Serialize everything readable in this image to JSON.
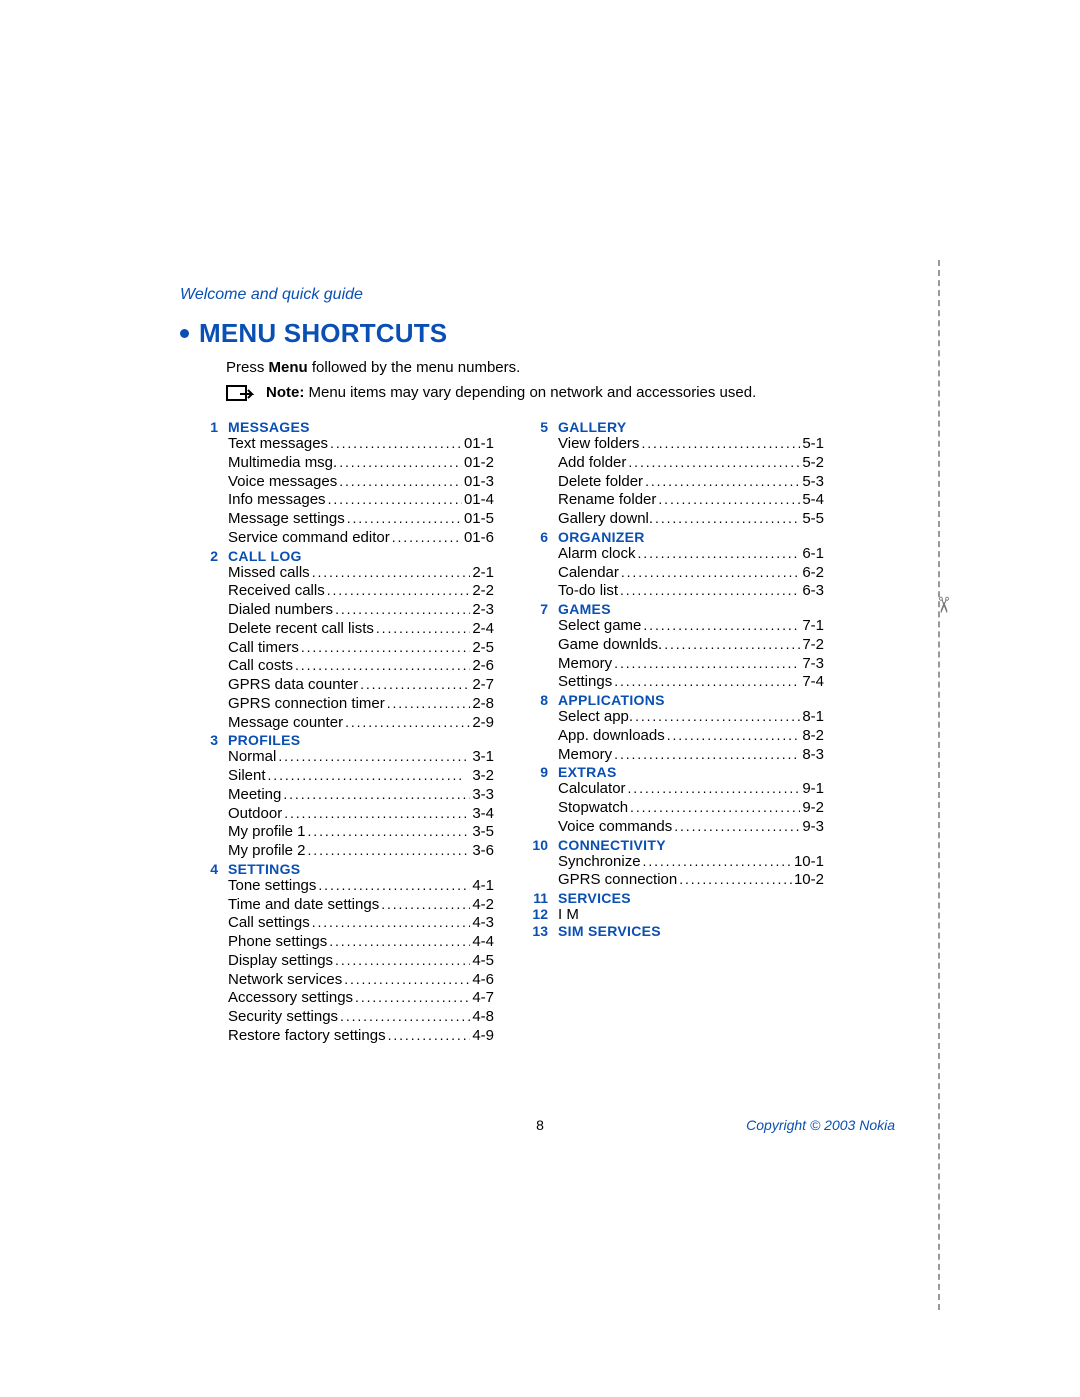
{
  "header_label": "Welcome and quick guide",
  "title": "MENU SHORTCUTS",
  "intro_prefix": "Press ",
  "intro_bold": "Menu",
  "intro_suffix": " followed by the menu numbers.",
  "note_bold": "Note:",
  "note_text": " Menu items may vary depending on network and accessories used.",
  "page_number": "8",
  "copyright": "Copyright © 2003 Nokia",
  "left": [
    {
      "num": "1",
      "title": "MESSAGES",
      "items": [
        {
          "label": "Text messages",
          "page": "01-1"
        },
        {
          "label": "Multimedia msg.",
          "page": "01-2"
        },
        {
          "label": "Voice messages",
          "page": "01-3"
        },
        {
          "label": "Info messages",
          "page": "01-4"
        },
        {
          "label": "Message settings",
          "page": "01-5"
        },
        {
          "label": "Service command editor",
          "page": "01-6"
        }
      ]
    },
    {
      "num": "2",
      "title": "CALL LOG",
      "items": [
        {
          "label": "Missed calls",
          "page": "2-1"
        },
        {
          "label": "Received calls",
          "page": "2-2"
        },
        {
          "label": "Dialed numbers",
          "page": "2-3"
        },
        {
          "label": "Delete recent call lists",
          "page": "2-4"
        },
        {
          "label": "Call timers",
          "page": "2-5"
        },
        {
          "label": "Call costs",
          "page": "2-6"
        },
        {
          "label": "GPRS data counter",
          "page": "2-7"
        },
        {
          "label": "GPRS connection timer",
          "page": "2-8"
        },
        {
          "label": "Message counter",
          "page": "2-9"
        }
      ]
    },
    {
      "num": "3",
      "title": "PROFILES",
      "items": [
        {
          "label": "Normal",
          "page": "3-1"
        },
        {
          "label": "Silent",
          "page": "3-2"
        },
        {
          "label": "Meeting",
          "page": "3-3"
        },
        {
          "label": "Outdoor",
          "page": "3-4"
        },
        {
          "label": "My profile 1",
          "page": "3-5"
        },
        {
          "label": "My profile 2",
          "page": "3-6"
        }
      ]
    },
    {
      "num": "4",
      "title": "SETTINGS",
      "items": [
        {
          "label": "Tone settings",
          "page": "4-1"
        },
        {
          "label": "Time and date settings",
          "page": "4-2"
        },
        {
          "label": "Call settings",
          "page": "4-3"
        },
        {
          "label": "Phone settings",
          "page": "4-4"
        },
        {
          "label": "Display settings",
          "page": "4-5"
        },
        {
          "label": "Network services",
          "page": "4-6"
        },
        {
          "label": "Accessory settings",
          "page": "4-7"
        },
        {
          "label": "Security settings",
          "page": "4-8"
        },
        {
          "label": "Restore factory settings",
          "page": "4-9"
        }
      ]
    }
  ],
  "right": [
    {
      "num": "5",
      "title": "GALLERY",
      "items": [
        {
          "label": "View folders",
          "page": "5-1"
        },
        {
          "label": "Add folder",
          "page": "5-2"
        },
        {
          "label": "Delete folder",
          "page": "5-3"
        },
        {
          "label": "Rename folder",
          "page": "5-4"
        },
        {
          "label": "Gallery downl.",
          "page": "5-5"
        }
      ]
    },
    {
      "num": "6",
      "title": "ORGANIZER",
      "items": [
        {
          "label": "Alarm clock",
          "page": "6-1"
        },
        {
          "label": "Calendar",
          "page": "6-2"
        },
        {
          "label": "To-do list",
          "page": "6-3"
        }
      ]
    },
    {
      "num": "7",
      "title": "GAMES",
      "items": [
        {
          "label": "Select game",
          "page": "7-1"
        },
        {
          "label": "Game downlds.",
          "page": "7-2"
        },
        {
          "label": "Memory",
          "page": "7-3"
        },
        {
          "label": "Settings",
          "page": "7-4"
        }
      ]
    },
    {
      "num": "8",
      "title": "APPLICATIONS",
      "items": [
        {
          "label": "Select app.",
          "page": "8-1"
        },
        {
          "label": "App. downloads",
          "page": "8-2"
        },
        {
          "label": "Memory",
          "page": "8-3"
        }
      ]
    },
    {
      "num": "9",
      "title": "EXTRAS",
      "items": [
        {
          "label": "Calculator",
          "page": "9-1"
        },
        {
          "label": "Stopwatch",
          "page": "9-2"
        },
        {
          "label": "Voice commands",
          "page": "9-3"
        }
      ]
    },
    {
      "num": "10",
      "title": "CONNECTIVITY",
      "items": [
        {
          "label": "Synchronize",
          "page": "10-1"
        },
        {
          "label": "GPRS connection",
          "page": "10-2"
        }
      ]
    },
    {
      "num": "11",
      "title": "SERVICES",
      "items": []
    },
    {
      "num": "12",
      "title": "I M",
      "plain": true,
      "items": []
    },
    {
      "num": "13",
      "title": "SIM SERVICES",
      "items": []
    }
  ]
}
